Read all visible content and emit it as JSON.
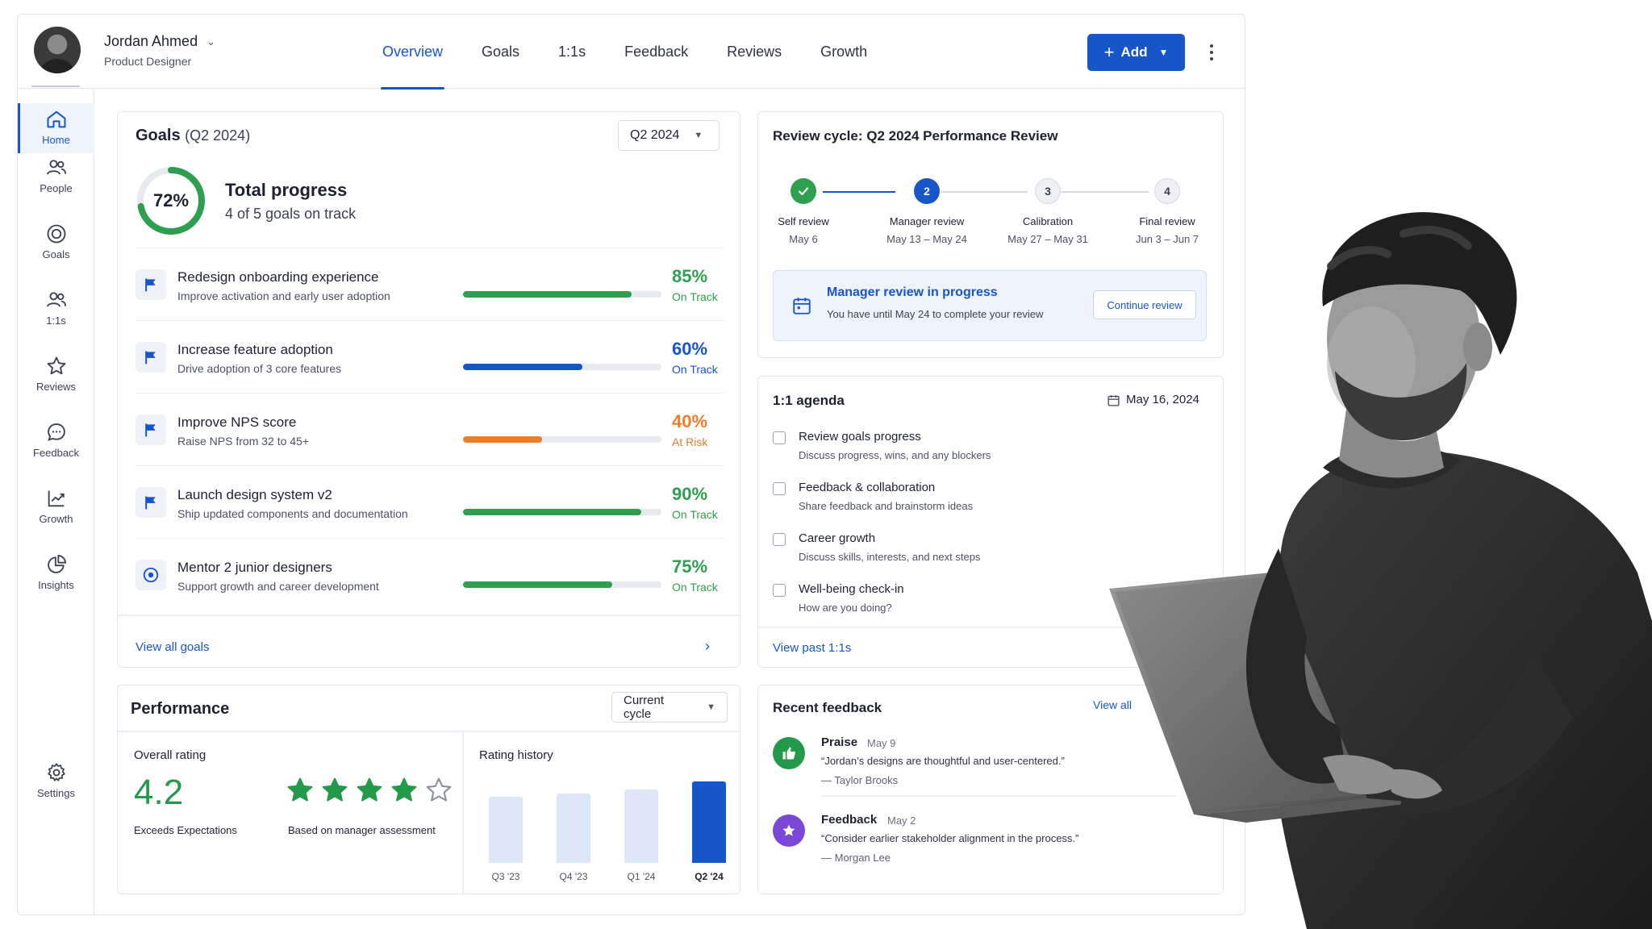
{
  "user": {
    "name": "Jordan Ahmed",
    "role": "Product Designer"
  },
  "tabs": [
    "Overview",
    "Goals",
    "1:1s",
    "Feedback",
    "Reviews",
    "Growth"
  ],
  "add_button": "Add",
  "sidebar": [
    {
      "label": "Home",
      "icon": "home-icon"
    },
    {
      "label": "People",
      "icon": "people-icon"
    },
    {
      "label": "Goals",
      "icon": "target-icon"
    },
    {
      "label": "1:1s",
      "icon": "one-on-one-icon"
    },
    {
      "label": "Reviews",
      "icon": "star-icon"
    },
    {
      "label": "Feedback",
      "icon": "chat-icon"
    },
    {
      "label": "Growth",
      "icon": "trend-icon"
    },
    {
      "label": "Insights",
      "icon": "pie-icon"
    },
    {
      "label": "Settings",
      "icon": "gear-icon"
    }
  ],
  "goals": {
    "title": "Goals",
    "period": "(Q2 2024)",
    "select": "Q2 2024",
    "progress_pct": 72,
    "progress_label": "72%",
    "total_title": "Total progress",
    "total_sub": "4 of 5 goals on track",
    "items": [
      {
        "title": "Redesign onboarding experience",
        "desc": "Improve activation and early user adoption",
        "pct": 85,
        "pct_label": "85%",
        "status": "On Track",
        "color": "#2e9e4f",
        "icon": "flag-icon"
      },
      {
        "title": "Increase feature adoption",
        "desc": "Drive adoption of 3 core features",
        "pct": 60,
        "pct_label": "60%",
        "status": "On Track",
        "color": "#1756c9",
        "icon": "flag-icon"
      },
      {
        "title": "Improve NPS score",
        "desc": "Raise NPS from 32 to 45+",
        "pct": 40,
        "pct_label": "40%",
        "status": "At Risk",
        "color": "#ee7d2a",
        "icon": "flag-icon"
      },
      {
        "title": "Launch design system v2",
        "desc": "Ship updated components and documentation",
        "pct": 90,
        "pct_label": "90%",
        "status": "On Track",
        "color": "#2e9e4f",
        "icon": "flag-icon"
      },
      {
        "title": "Mentor 2 junior designers",
        "desc": "Support growth and career development",
        "pct": 75,
        "pct_label": "75%",
        "status": "On Track",
        "color": "#2e9e4f",
        "icon": "target-icon"
      }
    ],
    "view_all": "View all goals"
  },
  "review": {
    "title": "Review cycle: Q2 2024 Performance Review",
    "steps": [
      {
        "num": "",
        "name": "Self review",
        "date": "May 6",
        "state": "done"
      },
      {
        "num": "2",
        "name": "Manager review",
        "date": "May 13 – May 24",
        "state": "current"
      },
      {
        "num": "3",
        "name": "Calibration",
        "date": "May 27 – May 31",
        "state": "todo"
      },
      {
        "num": "4",
        "name": "Final review",
        "date": "Jun 3 – Jun 7",
        "state": "todo"
      }
    ],
    "notice_title": "Manager review in progress",
    "notice_sub": "You have until May 24 to complete your review",
    "notice_button": "Continue review"
  },
  "agenda": {
    "title": "1:1 agenda",
    "date": "May 16, 2024",
    "items": [
      {
        "title": "Review goals progress",
        "sub": "Discuss progress, wins, and any blockers"
      },
      {
        "title": "Feedback & collaboration",
        "sub": "Share feedback and brainstorm ideas"
      },
      {
        "title": "Career growth",
        "sub": "Discuss skills, interests, and next steps"
      },
      {
        "title": "Well-being check-in",
        "sub": "How are you doing?"
      }
    ],
    "view_past": "View past 1:1s"
  },
  "performance": {
    "title": "Performance",
    "select": "Current cycle",
    "overall_label": "Overall rating",
    "rating": "4.2",
    "rating_stars": 4,
    "rating_desc": "Exceeds Expectations",
    "based_on": "Based on manager assessment",
    "history_label": "Rating history",
    "chart_data": {
      "type": "bar",
      "categories": [
        "Q3 '23",
        "Q4 '23",
        "Q1 '24",
        "Q2 '24"
      ],
      "values": [
        3.4,
        3.6,
        3.8,
        4.2
      ],
      "highlight_index": 3,
      "ylim": [
        0,
        4.5
      ]
    }
  },
  "feedback": {
    "title": "Recent feedback",
    "view_all": "View all",
    "items": [
      {
        "type": "Praise",
        "date": "May 9",
        "quote": "“Jordan’s designs are thoughtful and user-centered.”",
        "author": "— Taylor Brooks",
        "icon": "thumbs-up-icon",
        "color": "#229a4a"
      },
      {
        "type": "Feedback",
        "date": "May 2",
        "quote": "“Consider earlier stakeholder alignment in the process.”",
        "author": "— Morgan Lee",
        "icon": "star-icon",
        "color": "#7b47d6"
      }
    ]
  }
}
